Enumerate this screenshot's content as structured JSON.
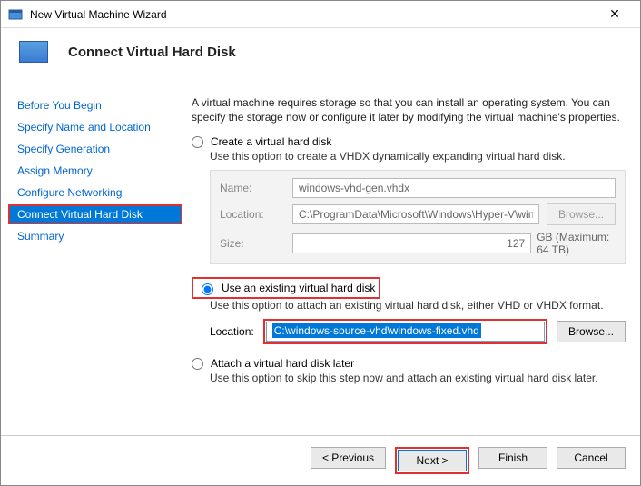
{
  "window": {
    "title": "New Virtual Machine Wizard",
    "header": "Connect Virtual Hard Disk"
  },
  "sidebar": {
    "items": [
      {
        "label": "Before You Begin"
      },
      {
        "label": "Specify Name and Location"
      },
      {
        "label": "Specify Generation"
      },
      {
        "label": "Assign Memory"
      },
      {
        "label": "Configure Networking"
      },
      {
        "label": "Connect Virtual Hard Disk"
      },
      {
        "label": "Summary"
      }
    ],
    "selected_index": 5
  },
  "main": {
    "intro": "A virtual machine requires storage so that you can install an operating system. You can specify the storage now or configure it later by modifying the virtual machine's properties.",
    "opt_create": {
      "label": "Create a virtual hard disk",
      "desc": "Use this option to create a VHDX dynamically expanding virtual hard disk.",
      "name_label": "Name:",
      "name_value": "windows-vhd-gen.vhdx",
      "location_label": "Location:",
      "location_value": "C:\\ProgramData\\Microsoft\\Windows\\Hyper-V\\windows-vhd-gen\\Vir",
      "browse": "Browse...",
      "size_label": "Size:",
      "size_value": "127",
      "size_unit": "GB (Maximum: 64 TB)"
    },
    "opt_existing": {
      "label": "Use an existing virtual hard disk",
      "desc": "Use this option to attach an existing virtual hard disk, either VHD or VHDX format.",
      "location_label": "Location:",
      "location_value": "C:\\windows-source-vhd\\windows-fixed.vhd",
      "browse": "Browse..."
    },
    "opt_later": {
      "label": "Attach a virtual hard disk later",
      "desc": "Use this option to skip this step now and attach an existing virtual hard disk later."
    }
  },
  "footer": {
    "previous": "< Previous",
    "next": "Next >",
    "finish": "Finish",
    "cancel": "Cancel"
  }
}
